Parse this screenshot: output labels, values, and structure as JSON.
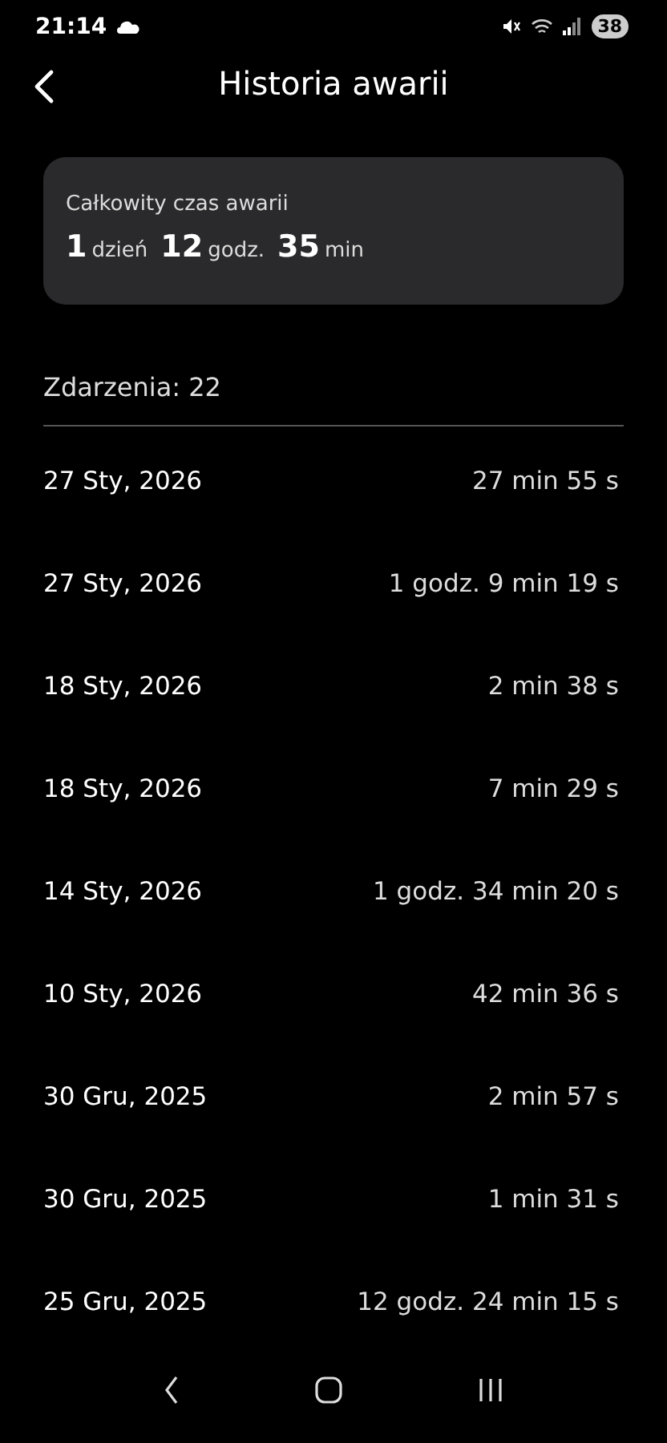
{
  "status_bar": {
    "time": "21:14",
    "battery": "38"
  },
  "header": {
    "title": "Historia awarii"
  },
  "summary": {
    "label": "Całkowity czas awarii",
    "total": [
      {
        "value": "1",
        "unit": "dzień"
      },
      {
        "value": "12",
        "unit": "godz."
      },
      {
        "value": "35",
        "unit": "min"
      }
    ]
  },
  "events_count": "Zdarzenia: 22",
  "events": [
    {
      "date": "27 Sty, 2026",
      "duration": "27 min 55 s"
    },
    {
      "date": "27 Sty, 2026",
      "duration": "1 godz. 9 min 19 s"
    },
    {
      "date": "18 Sty, 2026",
      "duration": "2 min 38 s"
    },
    {
      "date": "18 Sty, 2026",
      "duration": "7 min 29 s"
    },
    {
      "date": "14 Sty, 2026",
      "duration": "1 godz. 34 min 20 s"
    },
    {
      "date": "10 Sty, 2026",
      "duration": "42 min 36 s"
    },
    {
      "date": "30 Gru, 2025",
      "duration": "2 min 57 s"
    },
    {
      "date": "30 Gru, 2025",
      "duration": "1 min 31 s"
    },
    {
      "date": "25 Gru, 2025",
      "duration": "12 godz. 24 min 15 s"
    }
  ]
}
